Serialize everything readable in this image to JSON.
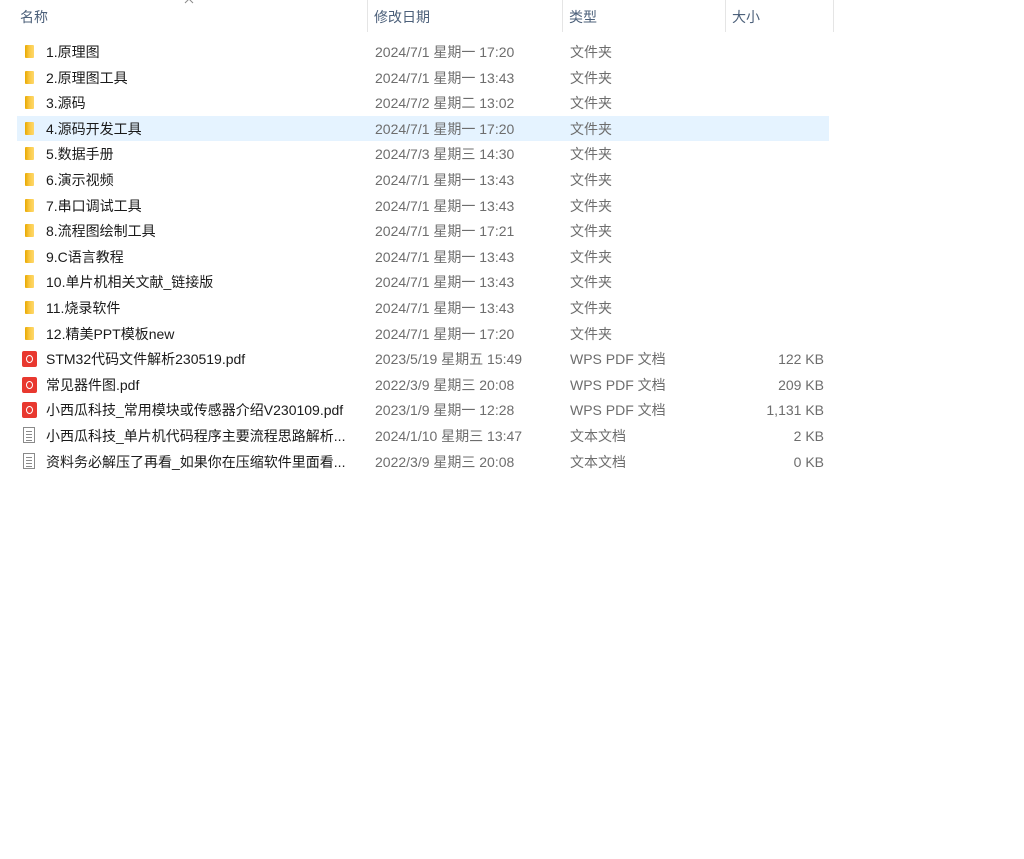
{
  "columns": {
    "name": "名称",
    "modified": "修改日期",
    "type": "类型",
    "size": "大小"
  },
  "sort": {
    "column": "name",
    "direction": "ascending",
    "icon": "chevron-up-icon"
  },
  "colors": {
    "selected_row": "#e5f3ff",
    "header_text": "#4c607a",
    "folder": "#f9c740",
    "pdf": "#e8382f"
  },
  "files": [
    {
      "name": "1.原理图",
      "modified": "2024/7/1 星期一 17:20",
      "type": "文件夹",
      "size": "",
      "icon": "folder-icon",
      "selected": false
    },
    {
      "name": "2.原理图工具",
      "modified": "2024/7/1 星期一 13:43",
      "type": "文件夹",
      "size": "",
      "icon": "folder-icon",
      "selected": false
    },
    {
      "name": "3.源码",
      "modified": "2024/7/2 星期二 13:02",
      "type": "文件夹",
      "size": "",
      "icon": "folder-icon",
      "selected": false
    },
    {
      "name": "4.源码开发工具",
      "modified": "2024/7/1 星期一 17:20",
      "type": "文件夹",
      "size": "",
      "icon": "folder-icon",
      "selected": true
    },
    {
      "name": "5.数据手册",
      "modified": "2024/7/3 星期三 14:30",
      "type": "文件夹",
      "size": "",
      "icon": "folder-icon",
      "selected": false
    },
    {
      "name": "6.演示视频",
      "modified": "2024/7/1 星期一 13:43",
      "type": "文件夹",
      "size": "",
      "icon": "folder-icon",
      "selected": false
    },
    {
      "name": "7.串口调试工具",
      "modified": "2024/7/1 星期一 13:43",
      "type": "文件夹",
      "size": "",
      "icon": "folder-icon",
      "selected": false
    },
    {
      "name": "8.流程图绘制工具",
      "modified": "2024/7/1 星期一 17:21",
      "type": "文件夹",
      "size": "",
      "icon": "folder-icon",
      "selected": false
    },
    {
      "name": "9.C语言教程",
      "modified": "2024/7/1 星期一 13:43",
      "type": "文件夹",
      "size": "",
      "icon": "folder-icon",
      "selected": false
    },
    {
      "name": "10.单片机相关文献_链接版",
      "modified": "2024/7/1 星期一 13:43",
      "type": "文件夹",
      "size": "",
      "icon": "folder-icon",
      "selected": false
    },
    {
      "name": "11.烧录软件",
      "modified": "2024/7/1 星期一 13:43",
      "type": "文件夹",
      "size": "",
      "icon": "folder-icon",
      "selected": false
    },
    {
      "name": "12.精美PPT模板new",
      "modified": "2024/7/1 星期一 17:20",
      "type": "文件夹",
      "size": "",
      "icon": "folder-icon",
      "selected": false
    },
    {
      "name": "STM32代码文件解析230519.pdf",
      "modified": "2023/5/19 星期五 15:49",
      "type": "WPS PDF 文档",
      "size": "122 KB",
      "icon": "pdf-icon",
      "selected": false
    },
    {
      "name": "常见器件图.pdf",
      "modified": "2022/3/9 星期三 20:08",
      "type": "WPS PDF 文档",
      "size": "209 KB",
      "icon": "pdf-icon",
      "selected": false
    },
    {
      "name": "小西瓜科技_常用模块或传感器介绍V230109.pdf",
      "modified": "2023/1/9 星期一 12:28",
      "type": "WPS PDF 文档",
      "size": "1,131 KB",
      "icon": "pdf-icon",
      "selected": false
    },
    {
      "name": "小西瓜科技_单片机代码程序主要流程思路解析...",
      "modified": "2024/1/10 星期三 13:47",
      "type": "文本文档",
      "size": "2 KB",
      "icon": "text-file-icon",
      "selected": false
    },
    {
      "name": "资料务必解压了再看_如果你在压缩软件里面看...",
      "modified": "2022/3/9 星期三 20:08",
      "type": "文本文档",
      "size": "0 KB",
      "icon": "text-file-icon",
      "selected": false
    }
  ]
}
